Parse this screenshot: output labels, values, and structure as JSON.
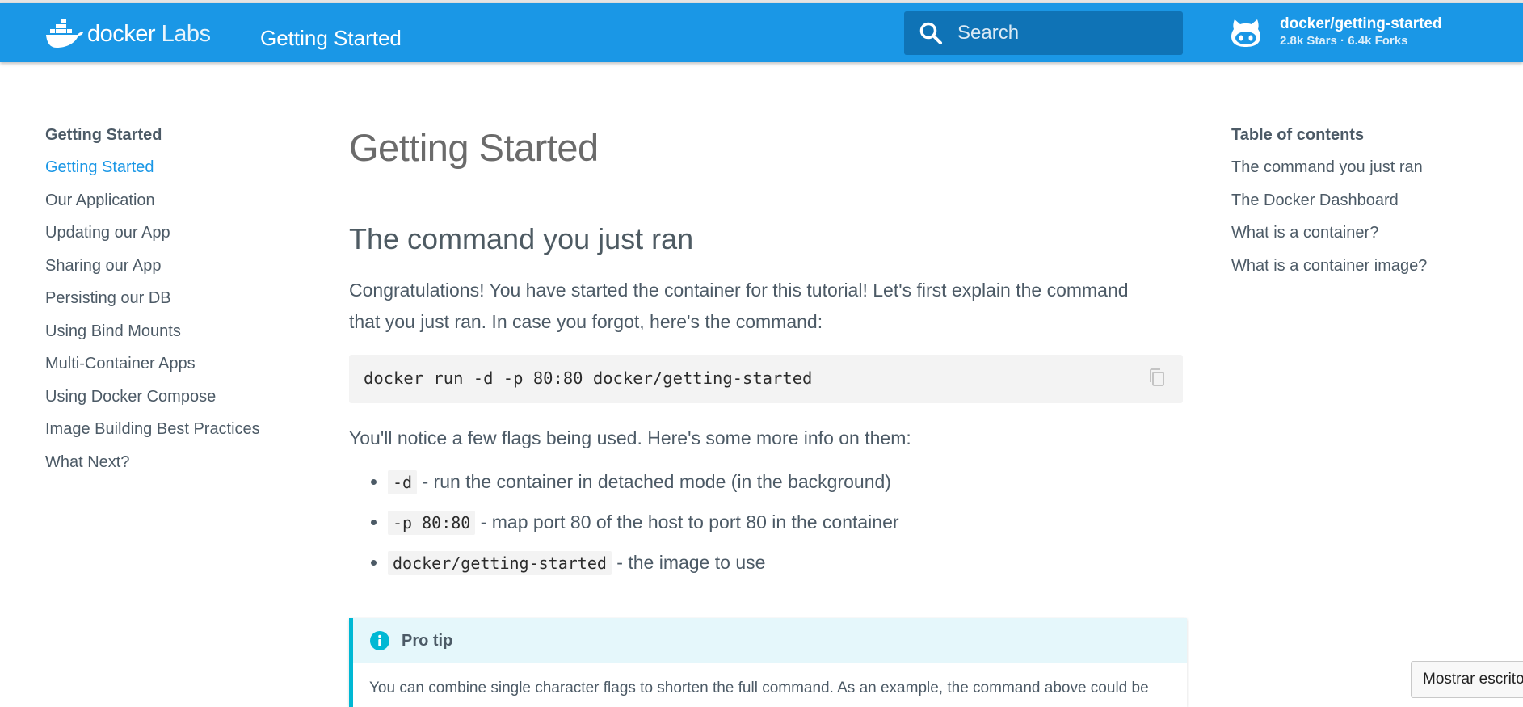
{
  "header": {
    "logo_docker": "docker",
    "logo_labs": "Labs",
    "title": "Getting Started",
    "search_placeholder": "Search",
    "repo_name": "docker/getting-started",
    "repo_facts": "2.8k Stars · 6.4k Forks",
    "accent_color": "#1a97e6"
  },
  "nav": {
    "title": "Getting Started",
    "items": [
      {
        "label": "Getting Started",
        "active": true
      },
      {
        "label": "Our Application"
      },
      {
        "label": "Updating our App"
      },
      {
        "label": "Sharing our App"
      },
      {
        "label": "Persisting our DB"
      },
      {
        "label": "Using Bind Mounts"
      },
      {
        "label": "Multi-Container Apps"
      },
      {
        "label": "Using Docker Compose"
      },
      {
        "label": "Image Building Best Practices"
      },
      {
        "label": "What Next?"
      }
    ]
  },
  "toc": {
    "title": "Table of contents",
    "items": [
      {
        "label": "The command you just ran"
      },
      {
        "label": "The Docker Dashboard"
      },
      {
        "label": "What is a container?"
      },
      {
        "label": "What is a container image?"
      }
    ]
  },
  "content": {
    "page_title": "Getting Started",
    "section_title": "The command you just ran",
    "intro_line1": "Congratulations! You have started the container for this tutorial! Let's first explain the command",
    "intro_line2": "that you just ran. In case you forgot, here's the command:",
    "command": "docker run -d -p 80:80 docker/getting-started",
    "flags_intro": "You'll notice a few flags being used. Here's some more info on them:",
    "flags": [
      {
        "code": "-d",
        "text": " - run the container in detached mode (in the background)"
      },
      {
        "code": "-p 80:80",
        "text": " - map port 80 of the host to port 80 in the container"
      },
      {
        "code": "docker/getting-started",
        "text": " - the image to use"
      }
    ]
  },
  "tip": {
    "title": "Pro tip",
    "body": "You can combine single character flags to shorten the full command. As an example, the command above could be"
  },
  "tooltip": {
    "text": "Mostrar escritorio"
  }
}
